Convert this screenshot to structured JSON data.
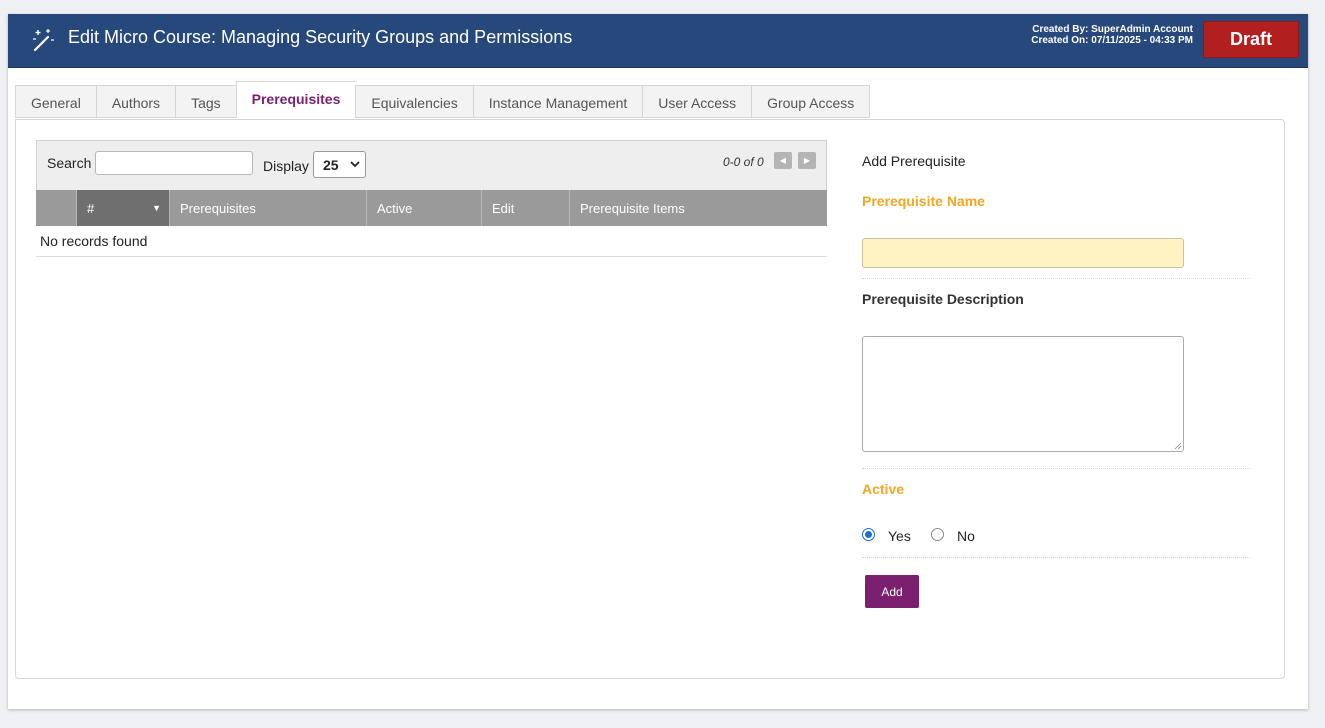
{
  "header": {
    "title": "Edit Micro Course: Managing Security Groups and Permissions",
    "created_by": "Created By: SuperAdmin Account",
    "created_on": "Created On: 07/11/2025 - 04:33 PM",
    "status_button": "Draft",
    "icon": "magic-wand-icon"
  },
  "tabs": [
    {
      "label": "General"
    },
    {
      "label": "Authors"
    },
    {
      "label": "Tags"
    },
    {
      "label": "Prerequisites",
      "active": true
    },
    {
      "label": "Equivalencies"
    },
    {
      "label": "Instance Management"
    },
    {
      "label": "User Access"
    },
    {
      "label": "Group Access"
    }
  ],
  "grid": {
    "search_label": "Search",
    "search_value": "",
    "display_label": "Display",
    "display_value": "25",
    "pager_text": "0-0 of 0",
    "columns": [
      "",
      "#",
      "Prerequisites",
      "Active",
      "Edit",
      "Prerequisite Items"
    ],
    "empty_message": "No records found"
  },
  "form": {
    "title": "Add Prerequisite",
    "name_label": "Prerequisite Name",
    "name_value": "",
    "description_label": "Prerequisite Description",
    "description_value": "",
    "active_label": "Active",
    "yes_label": "Yes",
    "no_label": "No",
    "active_selected": "Yes",
    "add_button": "Add"
  },
  "colors": {
    "header_bg": "#27487a",
    "draft_red": "#b21f1f",
    "accent_purple": "#7b1f6f",
    "required_orange": "#f5a623"
  }
}
